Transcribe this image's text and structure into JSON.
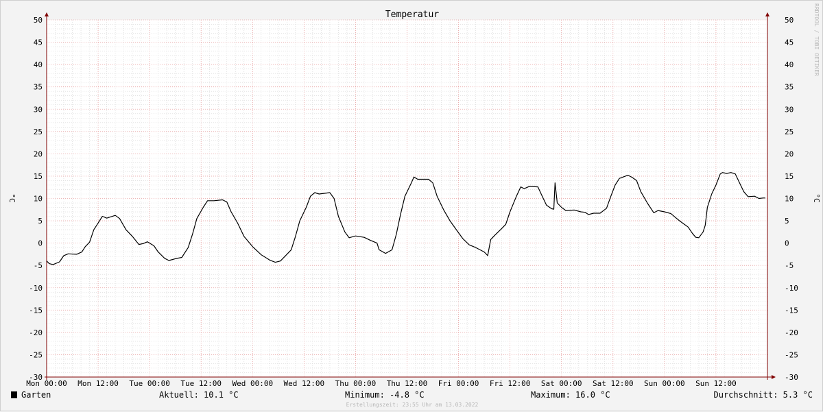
{
  "chart_data": {
    "type": "line",
    "title": "Temperatur",
    "ylabel_left": "°C",
    "ylabel_right": "°C",
    "ylim": [
      -30,
      50
    ],
    "y_ticks": [
      -30,
      -25,
      -20,
      -15,
      -10,
      -5,
      0,
      5,
      10,
      15,
      20,
      25,
      30,
      35,
      40,
      45,
      50
    ],
    "x_range_hours": [
      0,
      168
    ],
    "x_ticks": [
      {
        "label": "Mon 00:00",
        "hour": 0
      },
      {
        "label": "Mon 12:00",
        "hour": 12
      },
      {
        "label": "Tue 00:00",
        "hour": 24
      },
      {
        "label": "Tue 12:00",
        "hour": 36
      },
      {
        "label": "Wed 00:00",
        "hour": 48
      },
      {
        "label": "Wed 12:00",
        "hour": 60
      },
      {
        "label": "Thu 00:00",
        "hour": 72
      },
      {
        "label": "Thu 12:00",
        "hour": 84
      },
      {
        "label": "Fri 00:00",
        "hour": 96
      },
      {
        "label": "Fri 12:00",
        "hour": 108
      },
      {
        "label": "Sat 00:00",
        "hour": 120
      },
      {
        "label": "Sat 12:00",
        "hour": 132
      },
      {
        "label": "Sun 00:00",
        "hour": 144
      },
      {
        "label": "Sun 12:00",
        "hour": 156
      }
    ],
    "grid": true,
    "series": [
      {
        "name": "Garten",
        "color": "#000000",
        "points": [
          [
            0,
            -4.0
          ],
          [
            0.6,
            -4.6
          ],
          [
            1.5,
            -4.8
          ],
          [
            3,
            -4.2
          ],
          [
            4,
            -2.8
          ],
          [
            5,
            -2.4
          ],
          [
            7,
            -2.5
          ],
          [
            8.2,
            -2.0
          ],
          [
            9,
            -0.8
          ],
          [
            10,
            0.2
          ],
          [
            11,
            3.0
          ],
          [
            12,
            4.5
          ],
          [
            13,
            6.0
          ],
          [
            14,
            5.6
          ],
          [
            16,
            6.2
          ],
          [
            17,
            5.5
          ],
          [
            18.5,
            3.0
          ],
          [
            20,
            1.5
          ],
          [
            21.5,
            -0.3
          ],
          [
            22.5,
            -0.1
          ],
          [
            23.5,
            0.3
          ],
          [
            25,
            -0.6
          ],
          [
            26,
            -2.0
          ],
          [
            27.5,
            -3.4
          ],
          [
            28.5,
            -3.9
          ],
          [
            30,
            -3.5
          ],
          [
            31.5,
            -3.2
          ],
          [
            33,
            -1.0
          ],
          [
            34,
            2.0
          ],
          [
            35,
            5.5
          ],
          [
            36.5,
            8.0
          ],
          [
            37.5,
            9.5
          ],
          [
            39,
            9.5
          ],
          [
            41,
            9.7
          ],
          [
            42,
            9.2
          ],
          [
            43,
            7.0
          ],
          [
            44.5,
            4.5
          ],
          [
            46,
            1.5
          ],
          [
            48,
            -0.8
          ],
          [
            50,
            -2.6
          ],
          [
            52,
            -3.8
          ],
          [
            53.3,
            -4.3
          ],
          [
            54.5,
            -4.0
          ],
          [
            55.5,
            -3.0
          ],
          [
            57,
            -1.5
          ],
          [
            58,
            1.5
          ],
          [
            59,
            5.0
          ],
          [
            60.5,
            8.0
          ],
          [
            61.5,
            10.5
          ],
          [
            62.5,
            11.3
          ],
          [
            63.5,
            11.0
          ],
          [
            66,
            11.3
          ],
          [
            67,
            10.0
          ],
          [
            68,
            6.0
          ],
          [
            69.5,
            2.5
          ],
          [
            70.5,
            1.2
          ],
          [
            72,
            1.6
          ],
          [
            74,
            1.3
          ],
          [
            75.5,
            0.6
          ],
          [
            77,
            0.0
          ],
          [
            77.5,
            -1.5
          ],
          [
            79,
            -2.3
          ],
          [
            80.5,
            -1.5
          ],
          [
            81.5,
            2.0
          ],
          [
            82.5,
            6.5
          ],
          [
            83.5,
            10.5
          ],
          [
            85,
            13.5
          ],
          [
            85.6,
            14.8
          ],
          [
            86.5,
            14.3
          ],
          [
            89,
            14.3
          ],
          [
            90,
            13.5
          ],
          [
            91,
            10.5
          ],
          [
            92.5,
            7.5
          ],
          [
            94,
            5.0
          ],
          [
            95.5,
            3.0
          ],
          [
            97,
            1.0
          ],
          [
            98.5,
            -0.4
          ],
          [
            100,
            -1.0
          ],
          [
            101,
            -1.5
          ],
          [
            102,
            -2.0
          ],
          [
            102.8,
            -2.8
          ],
          [
            103.5,
            0.8
          ],
          [
            104.5,
            1.8
          ],
          [
            106,
            3.2
          ],
          [
            107,
            4.2
          ],
          [
            108,
            7.0
          ],
          [
            109.5,
            10.5
          ],
          [
            110.5,
            12.6
          ],
          [
            111.3,
            12.2
          ],
          [
            112.5,
            12.7
          ],
          [
            114.5,
            12.6
          ],
          [
            115.5,
            10.5
          ],
          [
            116.5,
            8.5
          ],
          [
            117.7,
            7.7
          ],
          [
            118.2,
            7.6
          ],
          [
            118.5,
            13.5
          ],
          [
            119,
            9.0
          ],
          [
            120,
            8.0
          ],
          [
            121,
            7.3
          ],
          [
            123,
            7.4
          ],
          [
            124.5,
            7.0
          ],
          [
            125.5,
            6.9
          ],
          [
            126.3,
            6.4
          ],
          [
            127.5,
            6.7
          ],
          [
            129,
            6.7
          ],
          [
            130.5,
            7.8
          ],
          [
            131.5,
            10.5
          ],
          [
            132.5,
            13.0
          ],
          [
            133.5,
            14.5
          ],
          [
            135.5,
            15.2
          ],
          [
            136.5,
            14.7
          ],
          [
            137.5,
            14.0
          ],
          [
            138.5,
            11.5
          ],
          [
            140,
            9.0
          ],
          [
            141.5,
            6.8
          ],
          [
            142.5,
            7.3
          ],
          [
            144,
            7.0
          ],
          [
            145.5,
            6.6
          ],
          [
            146.5,
            5.8
          ],
          [
            147.5,
            5.0
          ],
          [
            148.5,
            4.3
          ],
          [
            149.5,
            3.6
          ],
          [
            150.5,
            2.2
          ],
          [
            151.3,
            1.3
          ],
          [
            152,
            1.2
          ],
          [
            153,
            2.5
          ],
          [
            153.5,
            4.0
          ],
          [
            154,
            8.0
          ],
          [
            155,
            11.0
          ],
          [
            156,
            13.0
          ],
          [
            157,
            15.5
          ],
          [
            157.5,
            15.8
          ],
          [
            158.5,
            15.6
          ],
          [
            159.5,
            15.8
          ],
          [
            160.5,
            15.5
          ],
          [
            161.5,
            13.5
          ],
          [
            162.5,
            11.5
          ],
          [
            163.5,
            10.4
          ],
          [
            165,
            10.5
          ],
          [
            166,
            10.0
          ],
          [
            167,
            10.1
          ],
          [
            167.5,
            10.1
          ]
        ]
      }
    ]
  },
  "legend": {
    "series_label": "Garten",
    "swatch_color": "#000000",
    "aktuell": "Aktuell: 10.1 °C",
    "minimum": "Minimum: -4.8 °C",
    "maximum": "Maximum: 16.0 °C",
    "durchschnitt": "Durchschnitt: 5.3 °C"
  },
  "watermark": "RRDTOOL / TOBI OETIKER",
  "footer": "Erstellungszeit: 23:55 Uhr am 13.03.2022",
  "colors": {
    "background": "#f3f3f3",
    "plot_area": "#ffffff",
    "major_grid": "#e8a0a0",
    "minor_grid": "#d4d4d4",
    "axis": "#800000",
    "line": "#000000"
  }
}
